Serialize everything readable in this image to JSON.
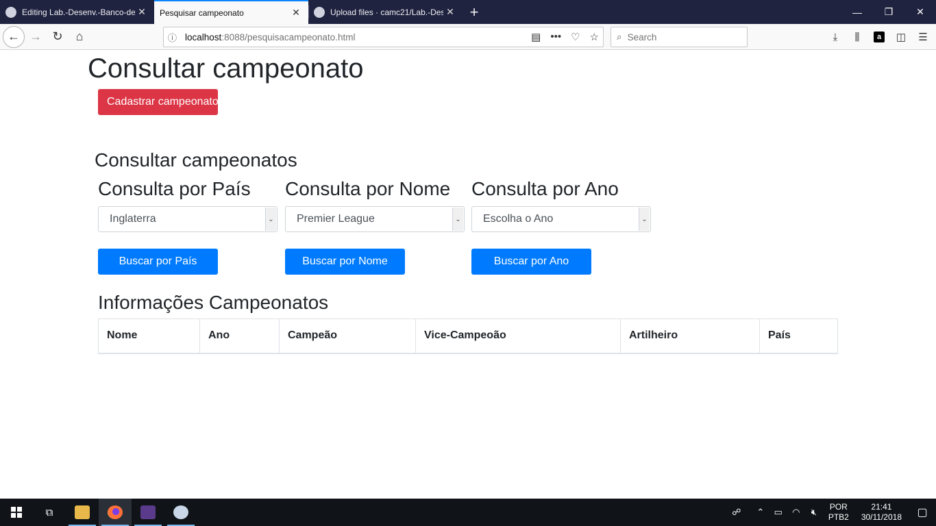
{
  "browser": {
    "tabs": [
      {
        "title": "Editing Lab.-Desenv.-Banco-de",
        "active": false
      },
      {
        "title": "Pesquisar campeonato",
        "active": true
      },
      {
        "title": "Upload files · camc21/Lab.-Des",
        "active": false
      }
    ],
    "url_host": "localhost",
    "url_path": ":8088/pesquisacampeonato.html",
    "search_placeholder": "Search"
  },
  "page": {
    "title": "Consultar campeonato",
    "cadastrar_button": "Cadastrar campeonatos",
    "section_title": "Consultar campeonatos",
    "filters": [
      {
        "heading": "Consulta por País",
        "selected": "Inglaterra",
        "button": "Buscar por País"
      },
      {
        "heading": "Consulta por Nome",
        "selected": "Premier League",
        "button": "Buscar por Nome"
      },
      {
        "heading": "Consulta por Ano",
        "selected": "Escolha o Ano",
        "button": "Buscar por Ano"
      }
    ],
    "info_title": "Informações Campeonatos",
    "table_headers": [
      "Nome",
      "Ano",
      "Campeão",
      "Vice-Campeoão",
      "Artilheiro",
      "País"
    ]
  },
  "taskbar": {
    "language": "POR",
    "layout": "PTB2",
    "time": "21:41",
    "date": "30/11/2018"
  },
  "colors": {
    "danger": "#dc3545",
    "primary": "#007bff",
    "tabbar": "#202340"
  }
}
